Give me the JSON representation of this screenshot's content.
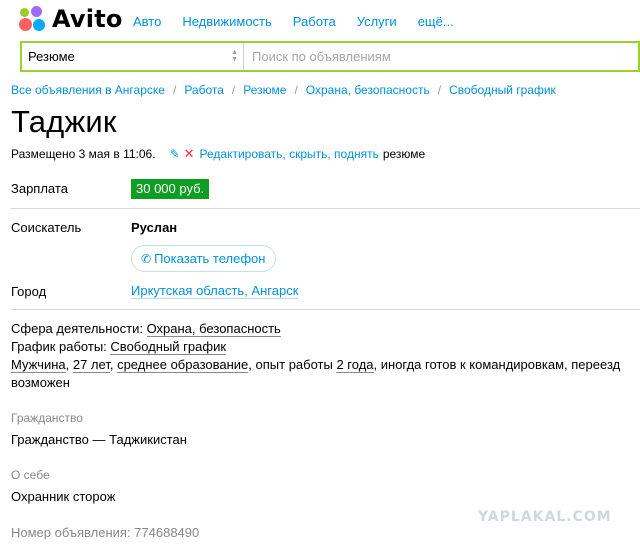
{
  "header": {
    "logo_text": "Avito",
    "nav": [
      "Авто",
      "Недвижимость",
      "Работа",
      "Услуги",
      "ещё..."
    ]
  },
  "search": {
    "category": "Резюме",
    "placeholder": "Поиск по объявлениям"
  },
  "breadcrumb": [
    "Все объявления в Ангарске",
    "Работа",
    "Резюме",
    "Охрана, безопасность",
    "Свободный график"
  ],
  "breadcrumb_separator": "/",
  "title": "Таджик",
  "meta": {
    "posted": "Размещено 3 мая в 11:06.",
    "actions": "Редактировать, скрыть, поднять",
    "tail": "резюме"
  },
  "details": {
    "salary_label": "Зарплата",
    "salary_value": "30 000 руб.",
    "seeker_label": "Соискатель",
    "seeker_name": "Руслан",
    "phone_button": "Показать телефон",
    "city_label": "Город",
    "city_value": "Иркутская область, Ангарск"
  },
  "description": {
    "sphere_label": "Сфера деятельности:",
    "sphere_value": "Охрана, безопасность",
    "schedule_label": "График работы:",
    "schedule_value": "Свободный график",
    "gender": "Мужчина",
    "age": "27 лет",
    "education": "среднее образование",
    "experience_prefix": "опыт работы",
    "experience": "2 года",
    "rest": "иногда готов к командировкам, переезд возможен"
  },
  "citizenship": {
    "label": "Гражданство",
    "text": "Гражданство — Таджикистан"
  },
  "about": {
    "label": "О себе",
    "text": "Охранник сторож"
  },
  "ad_number": "Номер объявления: 774688490",
  "watermark": "YAPLAKAL.COM",
  "colors": {
    "link": "#0091d9",
    "search_border": "#9ad12b",
    "salary_bg": "#0f9e24",
    "muted": "#888888"
  }
}
